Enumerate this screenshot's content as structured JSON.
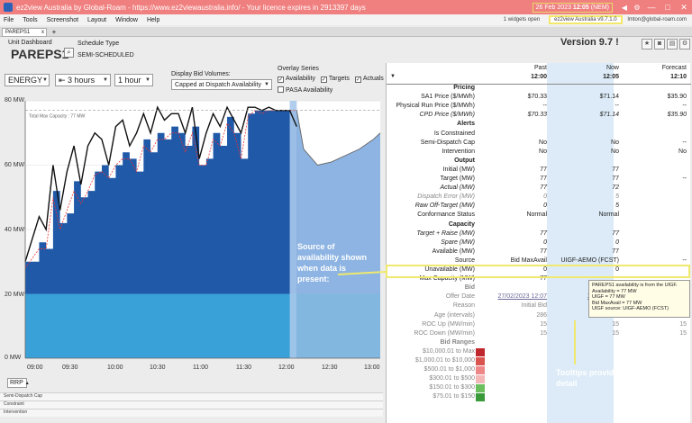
{
  "window": {
    "title": "ez2view Australia by Global-Roam - https://www.ez2viewaustralia.info/ - Your licence expires in 2913397 days",
    "date": "26 Feb 2023",
    "time": "12:05",
    "zone": "(NEM)",
    "minimize": "—",
    "maximize": "□",
    "close": "✕"
  },
  "menu": {
    "items": [
      "File",
      "Tools",
      "Screenshot",
      "Layout",
      "Window",
      "Help"
    ],
    "widgets_open": "1 widgets open",
    "version": "ez2view Australia v9.7.1.0",
    "user": "lmton@global-roam.com"
  },
  "tabs": {
    "active": "PAREPS1",
    "close": "x",
    "add": "+"
  },
  "header": {
    "unit_label": "Unit Dashboard",
    "unit_name": "PAREPS1",
    "schedule_label": "Schedule Type",
    "schedule_value": "SEMI-SCHEDULED",
    "version_big": "Version 9.7 !"
  },
  "controls": {
    "energy": "ENERGY",
    "hours": "3 hours",
    "interval": "1 hour",
    "bid_volumes_label": "Display Bid Volumes:",
    "bid_volumes_value": "Capped at Dispatch Availability",
    "overlay_label": "Overlay Series",
    "overlay": [
      "Availability",
      "Targets",
      "Actuals"
    ],
    "pasa": "PASA Availability"
  },
  "chart_data": {
    "type": "area",
    "y_ticks": [
      "80 MW",
      "60 MW",
      "40 MW",
      "20 MW",
      "0 MW"
    ],
    "ylim": [
      0,
      80
    ],
    "x_ticks": [
      "09:00",
      "09:30",
      "10:00",
      "10:30",
      "11:00",
      "11:30",
      "12:00",
      "12:30",
      "13:00"
    ],
    "annotation": "Total Max Capacity : 77 MW",
    "series": [
      {
        "name": "Availability",
        "x": [
          "08:50",
          "09:00",
          "09:05",
          "09:10",
          "09:15",
          "09:20",
          "09:25",
          "09:30",
          "09:35",
          "09:40",
          "09:45",
          "09:50",
          "09:55",
          "10:00",
          "10:05",
          "10:10",
          "10:15",
          "10:20",
          "10:25",
          "10:30",
          "10:35",
          "10:40",
          "10:45",
          "10:50",
          "10:55",
          "11:00",
          "11:05",
          "11:10",
          "11:15",
          "11:20",
          "11:25",
          "11:30",
          "11:35",
          "11:40",
          "11:45",
          "11:50",
          "11:55",
          "12:00",
          "12:05"
        ],
        "values": [
          30,
          36,
          34,
          52,
          42,
          45,
          55,
          50,
          52,
          58,
          60,
          56,
          60,
          64,
          62,
          58,
          68,
          64,
          70,
          68,
          72,
          70,
          66,
          72,
          60,
          62,
          70,
          66,
          75,
          70,
          62,
          76,
          77,
          77,
          77,
          77,
          77,
          77,
          77
        ]
      },
      {
        "name": "Targets",
        "x": [
          "08:50",
          "09:00",
          "09:05",
          "09:10",
          "09:15",
          "09:20",
          "09:25",
          "09:30",
          "09:35",
          "09:40",
          "09:45",
          "09:50",
          "09:55",
          "10:00",
          "10:05",
          "10:10",
          "10:15",
          "10:20",
          "10:25",
          "10:30",
          "10:35",
          "10:40",
          "10:45",
          "10:50",
          "10:55",
          "11:00",
          "11:05",
          "11:10",
          "11:15",
          "11:20",
          "11:25",
          "11:30",
          "11:35",
          "11:40",
          "11:45",
          "11:50",
          "11:55",
          "12:00",
          "12:05"
        ],
        "values": [
          28,
          34,
          34,
          50,
          40,
          46,
          52,
          48,
          52,
          57,
          58,
          56,
          60,
          62,
          62,
          58,
          66,
          64,
          68,
          68,
          70,
          70,
          64,
          70,
          60,
          60,
          68,
          66,
          73,
          70,
          62,
          75,
          77,
          76,
          77,
          77,
          77,
          77,
          77
        ]
      },
      {
        "name": "Actuals",
        "x": [
          "08:50",
          "09:00",
          "09:05",
          "09:10",
          "09:15",
          "09:20",
          "09:25",
          "09:30",
          "09:35",
          "09:40",
          "09:45",
          "09:50",
          "09:55",
          "10:00",
          "10:05",
          "10:10",
          "10:15",
          "10:20",
          "10:25",
          "10:30",
          "10:35",
          "10:40",
          "10:45",
          "10:50",
          "10:55",
          "11:00",
          "11:05",
          "11:10",
          "11:15",
          "11:20",
          "11:25",
          "11:30",
          "11:35",
          "11:40",
          "11:45",
          "11:50",
          "11:55",
          "12:00",
          "12:05"
        ],
        "values": [
          30,
          44,
          40,
          60,
          46,
          58,
          66,
          54,
          66,
          70,
          68,
          60,
          72,
          74,
          66,
          70,
          76,
          70,
          78,
          74,
          76,
          76,
          70,
          78,
          62,
          70,
          76,
          72,
          78,
          74,
          70,
          78,
          78,
          77,
          78,
          77,
          77,
          77,
          72
        ]
      },
      {
        "name": "Forecast Availability",
        "x": [
          "12:05",
          "12:10",
          "12:20",
          "12:30",
          "12:40",
          "12:50",
          "13:00",
          "13:05"
        ],
        "values": [
          77,
          65,
          60,
          61,
          63,
          65,
          68,
          70
        ]
      }
    ]
  },
  "chart_labels": {
    "rrp": "RRP",
    "rows": [
      "Semi-Dispatch Cap",
      "Constraint",
      "Intervention"
    ]
  },
  "table": {
    "columns": [
      {
        "head": "Past",
        "time": "12:00"
      },
      {
        "head": "Now",
        "time": "12:05"
      },
      {
        "head": "Forecast",
        "time": "12:10"
      }
    ],
    "rows": [
      {
        "type": "section",
        "label": "Pricing"
      },
      {
        "label": "SA1 Price ($/MWh)",
        "v": [
          "$70.33",
          "$71.14",
          "$35.90"
        ]
      },
      {
        "label": "Physical Run Price ($/MWh)",
        "v": [
          "--",
          "--",
          "--"
        ]
      },
      {
        "label": "CPD Price ($/MWh)",
        "v": [
          "$70.33",
          "$71.14",
          "$35.90"
        ],
        "style": "italic"
      },
      {
        "type": "section",
        "label": "Alerts"
      },
      {
        "label": "Is Constrained",
        "v": [
          "",
          "",
          ""
        ]
      },
      {
        "label": "Semi-Dispatch Cap",
        "v": [
          "No",
          "No",
          "--"
        ]
      },
      {
        "label": "Intervention",
        "v": [
          "No",
          "No",
          "No"
        ]
      },
      {
        "type": "section",
        "label": "Output"
      },
      {
        "label": "Initial (MW)",
        "v": [
          "77",
          "77",
          ""
        ]
      },
      {
        "label": "Target (MW)",
        "v": [
          "77",
          "77",
          "--"
        ]
      },
      {
        "label": "Actual (MW)",
        "v": [
          "77",
          "72",
          ""
        ],
        "style": "italic"
      },
      {
        "label": "Dispatch Error (MW)",
        "v": [
          "0",
          "5",
          ""
        ],
        "style": "italic grey"
      },
      {
        "label": "Raw Off-Target (MW)",
        "v": [
          "0",
          "5",
          ""
        ],
        "style": "italic"
      },
      {
        "label": "Conformance Status",
        "v": [
          "Normal",
          "Normal",
          ""
        ]
      },
      {
        "type": "section",
        "label": "Capacity"
      },
      {
        "label": "Target + Raise (MW)",
        "v": [
          "77",
          "77",
          ""
        ],
        "style": "italic"
      },
      {
        "label": "Spare (MW)",
        "v": [
          "0",
          "0",
          ""
        ],
        "style": "italic"
      },
      {
        "label": "Available (MW)",
        "v": [
          "77",
          "77",
          ""
        ]
      },
      {
        "label": "Source",
        "v": [
          "Bid MaxAvail",
          "UIGF-AEMO (FCST)",
          "--"
        ]
      },
      {
        "label": "Unavailable (MW)",
        "v": [
          "0",
          "0",
          ""
        ]
      },
      {
        "label": "Max Capacity (MW)",
        "v": [
          "77",
          "",
          ""
        ]
      },
      {
        "type": "section",
        "label": "Bid",
        "style": "grey"
      },
      {
        "label": "Offer Date",
        "v": [
          "27/02/2023 12:07",
          "27/02/2023",
          ""
        ],
        "style": "grey link"
      },
      {
        "label": "Reason",
        "v": [
          "Initial Bid",
          "",
          ""
        ],
        "style": "grey"
      },
      {
        "label": "Age (intervals)",
        "v": [
          "286",
          "287",
          "288"
        ],
        "style": "grey"
      },
      {
        "label": "ROC Up (MW/min)",
        "v": [
          "15",
          "15",
          "15"
        ],
        "style": "grey"
      },
      {
        "label": "ROC Down (MW/min)",
        "v": [
          "15",
          "15",
          "15"
        ],
        "style": "grey"
      },
      {
        "type": "section",
        "label": "Bid Ranges",
        "style": "grey"
      },
      {
        "label": "$10,000.01 to Max",
        "v": [
          "",
          "",
          ""
        ],
        "style": "grey",
        "color": "#c0272d"
      },
      {
        "label": "$1,000.01 to $10,000",
        "v": [
          "",
          "",
          ""
        ],
        "style": "grey",
        "color": "#d9534f"
      },
      {
        "label": "$500.01 to $1,000",
        "v": [
          "",
          "",
          ""
        ],
        "style": "grey",
        "color": "#e88"
      },
      {
        "label": "$300.01 to $500",
        "v": [
          "",
          "",
          ""
        ],
        "style": "grey",
        "color": "#f4b6b6"
      },
      {
        "label": "$150.01 to $300",
        "v": [
          "",
          "",
          ""
        ],
        "style": "grey",
        "color": "#6cbf5e"
      },
      {
        "label": "$75.01 to $150",
        "v": [
          "",
          "",
          ""
        ],
        "style": "grey",
        "color": "#3a9a3a"
      }
    ]
  },
  "tooltip": {
    "lines": [
      "PAREPS1 availability is from the UIGF.",
      "Availability = 77 MW",
      "UIGF = 77 MW",
      "Bid MaxAvail = 77 MW",
      "UIGF source: UIGF-AEMO (FCST)"
    ]
  },
  "annotations": {
    "source": "Source of availability shown when data is present:",
    "tooltips": "Tooltips provide detail"
  },
  "colors": {
    "titlebar": "#f07f7f",
    "highlight": "#f0e96e",
    "bid_dark": "#1f59a8",
    "bid_light": "#3aa0d8",
    "forecast": "#8db4e2",
    "now_col": "#dcebf7"
  }
}
